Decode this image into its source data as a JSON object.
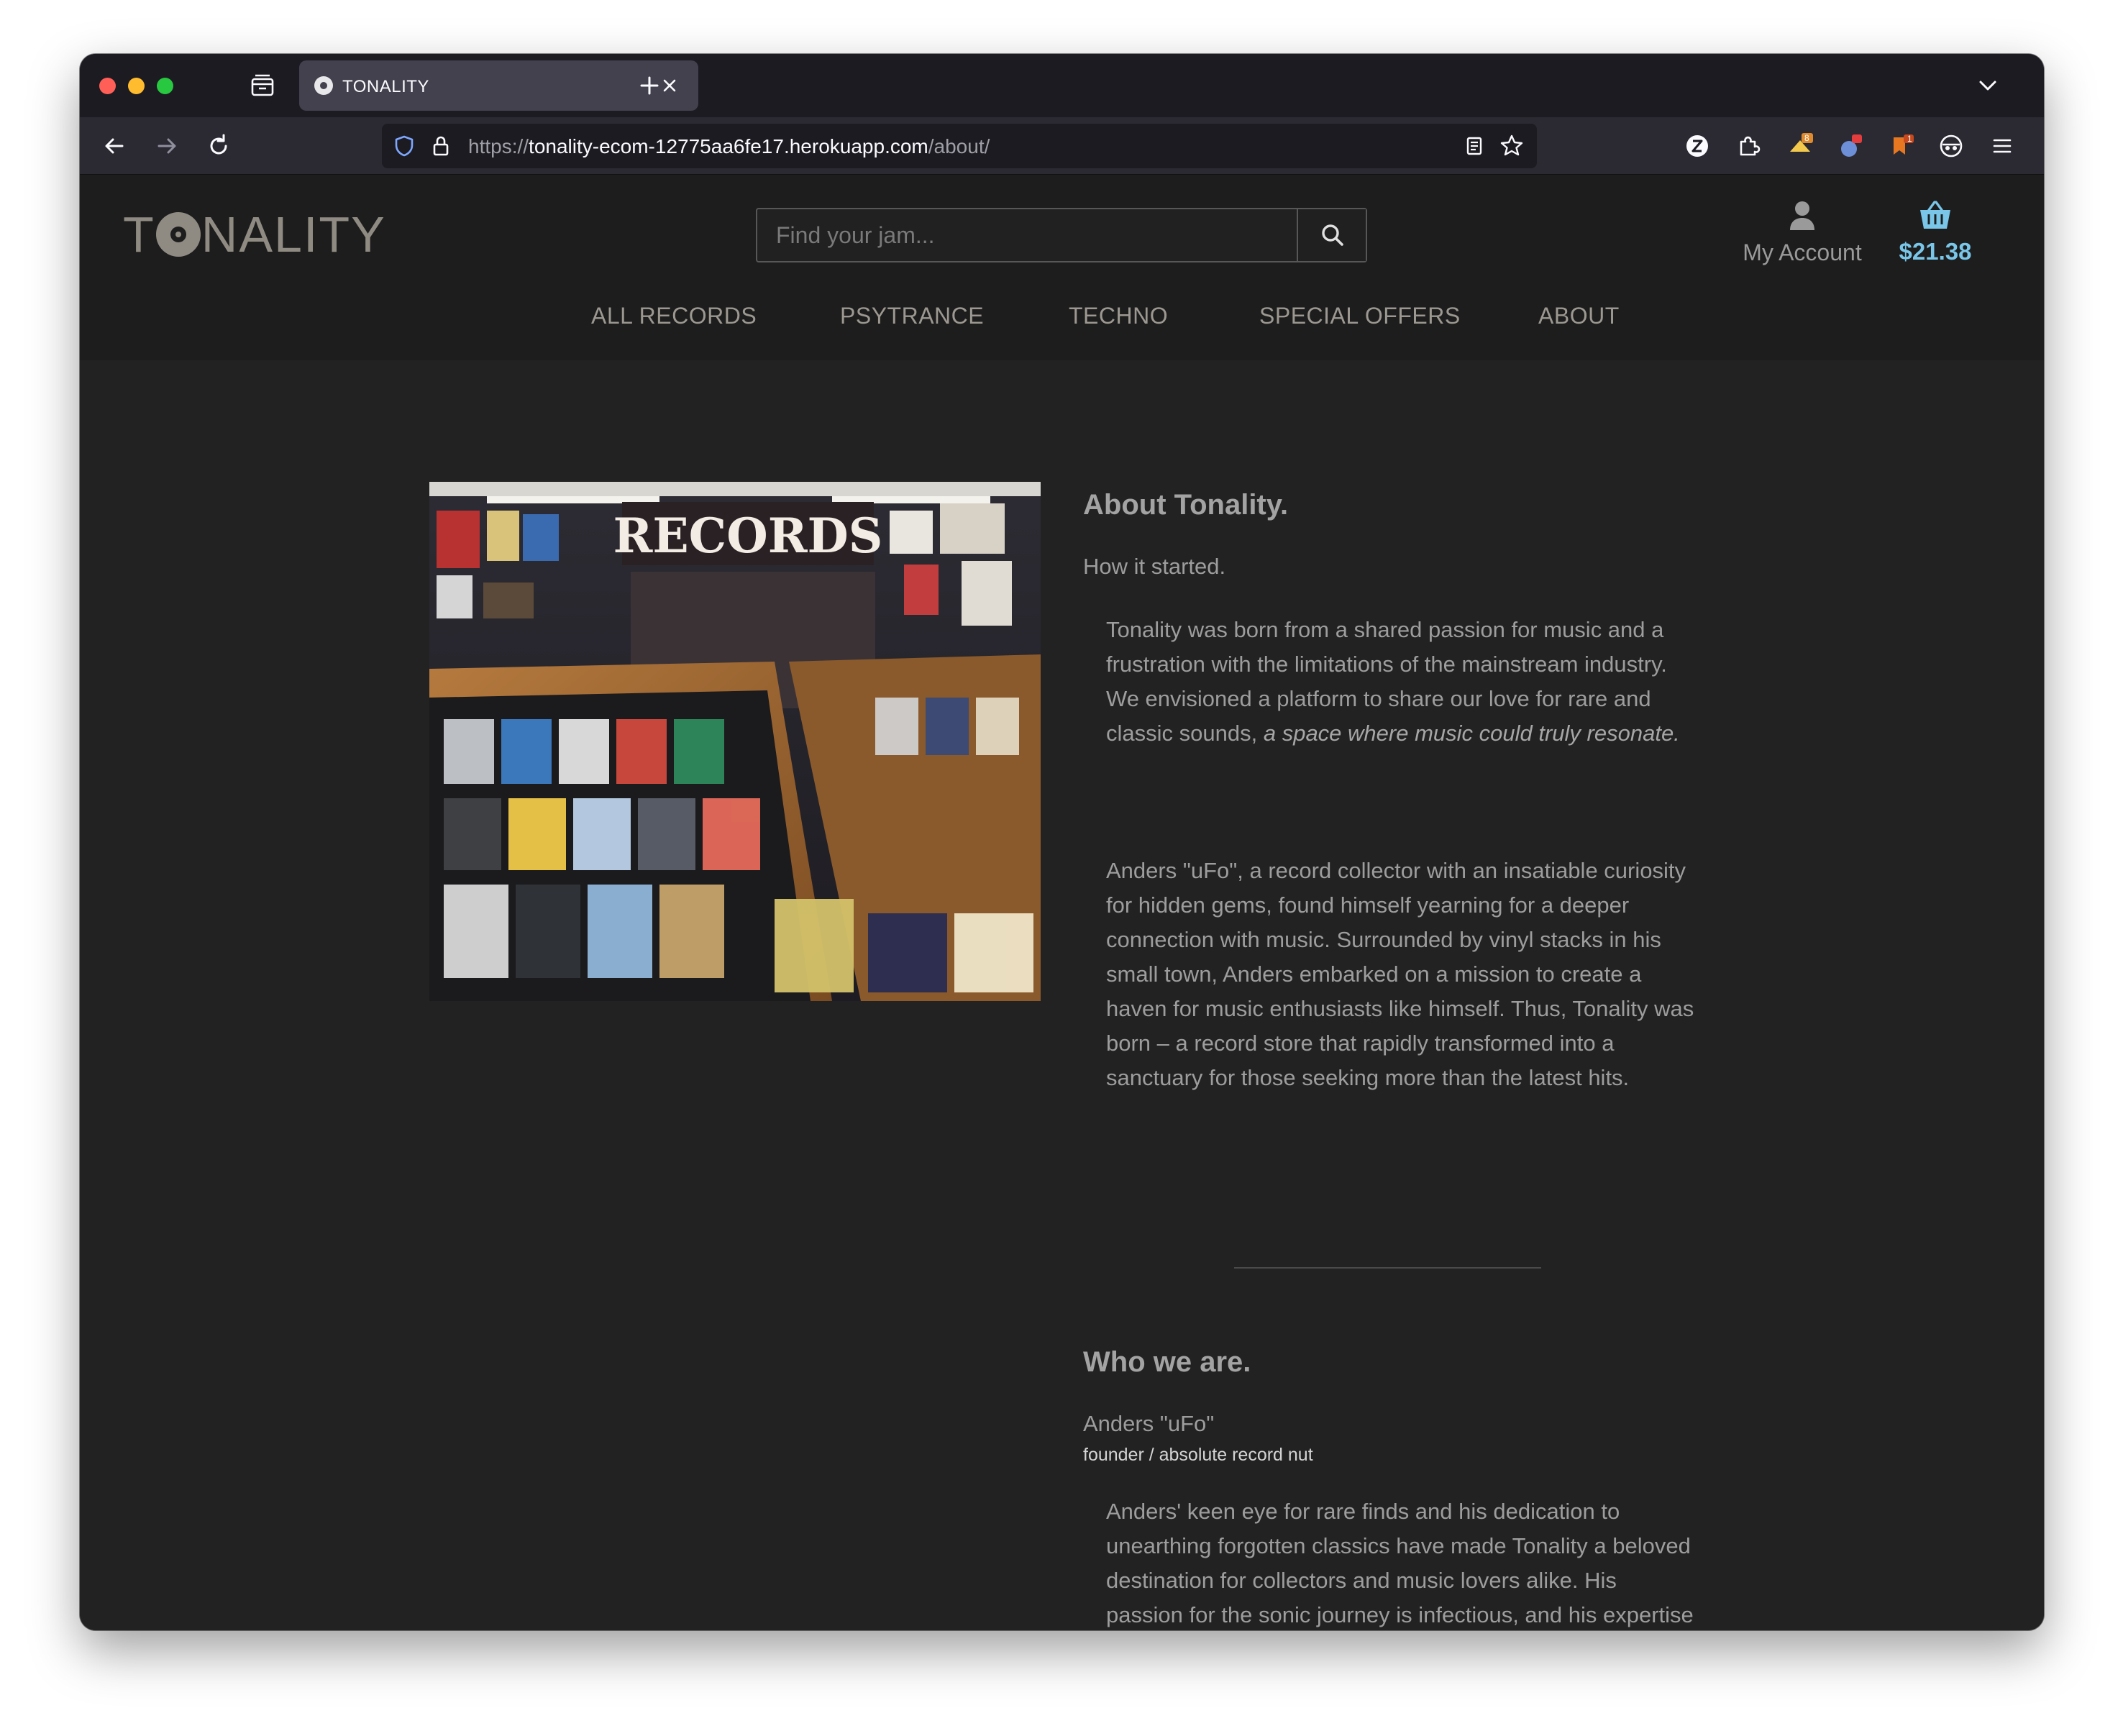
{
  "browser": {
    "tab_title": "TONALITY",
    "url_prefix": "https://",
    "url_host": "tonality-ecom-12775aa6fe17.herokuapp.com",
    "url_path": "/about/",
    "ext_badge_1": "8",
    "ext_badge_2": "1"
  },
  "site": {
    "logo_left": "T",
    "logo_right": "NALITY",
    "search_placeholder": "Find your jam...",
    "account_label": "My Account",
    "basket_total": "$21.38",
    "accent_color": "#79c6e8",
    "nav": [
      "ALL RECORDS",
      "PSYTRANCE",
      "TECHNO",
      "SPECIAL OFFERS",
      "ABOUT"
    ]
  },
  "about": {
    "heading": "About Tonality.",
    "subheading": "How it started.",
    "para1_plain": "Tonality was born from a shared passion for music and a frustration with the limitations of the mainstream industry. We envisioned a platform to share our love for rare and classic sounds,",
    "para1_em": "a space where music could truly resonate.",
    "para2": "Anders \"uFo\", a record collector with an insatiable curiosity for hidden gems, found himself yearning for a deeper connection with music. Surrounded by vinyl stacks in his small town, Anders embarked on a mission to create a haven for music enthusiasts like himself. Thus, Tonality was born – a record store that rapidly transformed into a sanctuary for those seeking more than the latest hits.",
    "image_sign": "RECORDS",
    "who_heading": "Who we are.",
    "member_name": "Anders \"uFo\"",
    "member_role": "founder / absolute record nut",
    "member_bio": "Anders' keen eye for rare finds and his dedication to unearthing forgotten classics have made Tonality a beloved destination for collectors and music lovers alike. His passion for the sonic journey is infectious, and his expertise is a cornerstone of the Tonality experience."
  }
}
